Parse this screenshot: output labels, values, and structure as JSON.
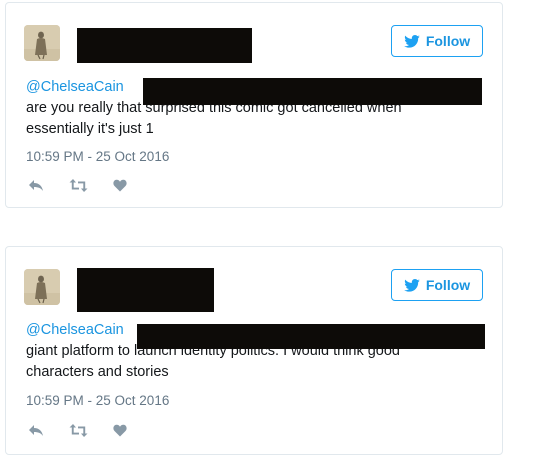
{
  "colors": {
    "link": "#1b95e0",
    "border": "#e1e8ed",
    "meta_text": "#657786",
    "body_text": "#14171a",
    "redaction": "#0d0b08"
  },
  "tweets": [
    {
      "follow_label": "Follow",
      "mention": "@ChelseaCain",
      "text_line1_suffix": "",
      "text_line2": "are you really that surprised this comic got cancelled when",
      "text_line3": "essentially it's just 1",
      "timestamp": "10:59 PM - 25 Oct 2016",
      "icons": [
        "reply-icon",
        "retweet-icon",
        "like-icon"
      ]
    },
    {
      "follow_label": "Follow",
      "mention": "@ChelseaCain",
      "text_line1_suffix": "",
      "text_line2": "giant platform to launch identity politics. I would think good",
      "text_line3": "characters and stories",
      "timestamp": "10:59 PM - 25 Oct 2016",
      "icons": [
        "reply-icon",
        "retweet-icon",
        "like-icon"
      ]
    }
  ]
}
